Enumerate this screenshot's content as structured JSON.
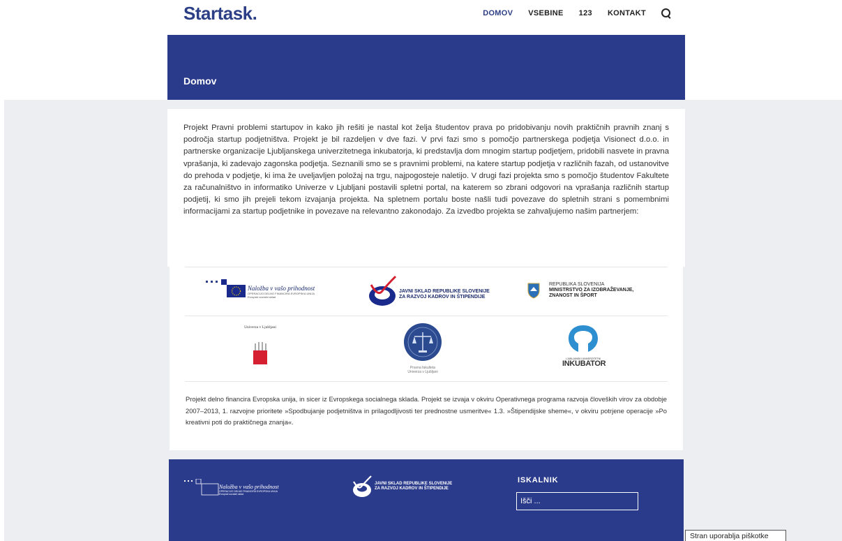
{
  "brand": {
    "name": "Startask."
  },
  "nav": {
    "items": [
      "DOMOV",
      "VSEBINE",
      "123",
      "KONTAKT"
    ],
    "search_icon": "search-icon"
  },
  "page": {
    "title": "Domov"
  },
  "intro": {
    "text": "Projekt Pravni problemi startupov in kako jih rešiti je nastal kot želja študentov prava po pridobivanju novih praktičnih pravnih znanj s področja startup podjetništva. Projekt je bil razdeljen v dve fazi. V prvi fazi smo s pomočjo partnerskega podjetja Visionect d.o.o. in partnerske organizacije Ljubljanskega univerzitetnega inkubatorja, ki predstavlja dom mnogim startup podjetjem, pridobili nasvete in pravna vprašanja, ki zadevajo zagonska podjetja. Seznanili smo se s pravnimi problemi, na katere startup podjetja v različnih fazah, od ustanovitve do prehoda v podjetje, ki ima že uveljavljen položaj na trgu, najpogosteje naletijo. V drugi fazi projekta smo s pomočjo študentov Fakultete za računalništvo in informatiko Univerze v Ljubljani postavili spletni portal, na katerem so zbrani odgovori na vprašanja različnih startup podjetij, ki smo jih prejeli tekom izvajanja projekta. Na spletnem portalu boste našli tudi povezave do spletnih strani s pomembnimi informacijami za startup podjetnike in povezave na relevantno zakonodajo. Za izvedbo projekta se zahvaljujemo našim partnerjem:"
  },
  "partners": {
    "eu": {
      "line1": "Naložba v vašo prihodnost",
      "line2": "OPERACIJO DELNO FINANCIRA EVROPSKA UNIJA",
      "line3": "Evropski socialni sklad"
    },
    "sklad": {
      "line1": "JAVNI SKLAD REPUBLIKE SLOVENIJE",
      "line2": "ZA RAZVOJ KADROV IN ŠTIPENDIJE"
    },
    "ministrstvo": {
      "line1": "REPUBLIKA SLOVENIJA",
      "line2": "MINISTRSTVO ZA IZOBRAŽEVANJE,",
      "line3": "ZNANOST IN ŠPORT"
    },
    "uni": {
      "name": "Univerza v Ljubljani"
    },
    "pf": {
      "line1": "Pravna fakulteta",
      "line2": "Univerza v Ljubljani"
    },
    "inkubator": {
      "small": "LJUBLJANSKI UNIVERZITETNI",
      "big": "INKUBATOR"
    }
  },
  "financing": {
    "text": "Projekt delno financira Evropska unija, in sicer iz Evropskega socialnega sklada. Projekt se izvaja v okviru Operativnega programa razvoja človeških virov za obdobje 2007–2013, 1. razvojne prioritete »Spodbujanje podjetništva in prilagodljivosti ter prednostne usmeritve« 1.3. »Štipendijske sheme«, v okviru potrjene operacije »Po kreativni poti do praktičnega znanja«."
  },
  "footer": {
    "search_title": "ISKALNIK",
    "search_placeholder": "Išči ..."
  },
  "cookie": {
    "text": "Stran uporablja piškotke"
  },
  "colors": {
    "brand": "#2c3e86",
    "banner": "#2b3b8c",
    "page_bg": "#eceef1",
    "accent_red": "#d42030"
  }
}
